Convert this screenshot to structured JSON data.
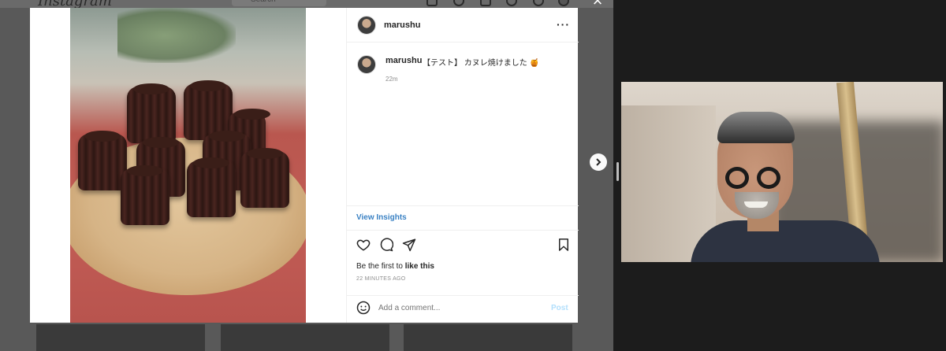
{
  "instagram": {
    "logo": "Instagram",
    "search_placeholder": "Search"
  },
  "post": {
    "header_username": "marushu",
    "caption_username": "marushu",
    "caption_text": "【テスト】 カヌレ焼けました 🍯",
    "caption_time": "22m",
    "view_insights": "View Insights",
    "likes_prefix": "Be the first to ",
    "likes_bold": "like this",
    "posted_time": "22 MINUTES AGO",
    "comment_placeholder": "Add a comment...",
    "post_button": "Post"
  },
  "icons": {
    "more": "more-options-icon",
    "like": "heart-icon",
    "comment": "comment-icon",
    "share": "paper-plane-icon",
    "save": "bookmark-icon",
    "emoji": "emoji-icon",
    "next": "chevron-right-icon",
    "close": "close-icon"
  },
  "colors": {
    "link_blue": "#3b82c4",
    "post_disabled": "#b2dffc",
    "muted_text": "#8e8e8e"
  }
}
